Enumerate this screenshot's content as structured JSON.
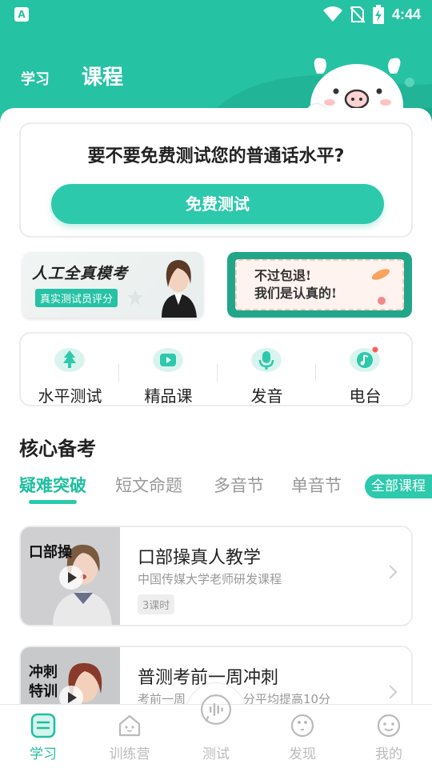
{
  "status_bar": {
    "time": "4:44",
    "left_icon": "A"
  },
  "header": {
    "tabs": [
      {
        "label": "学习"
      },
      {
        "label": "课程"
      }
    ]
  },
  "test_card": {
    "title": "要不要免费测试您的普通话水平?",
    "button": "免费测试"
  },
  "banners": {
    "left": {
      "title": "人工全真模考",
      "badge": "真实测试员评分"
    },
    "right": {
      "line1": "不过包退!",
      "line2": "我们是认真的!"
    }
  },
  "menu": [
    {
      "label": "水平测试",
      "icon": "tree-icon"
    },
    {
      "label": "精品课",
      "icon": "video-icon"
    },
    {
      "label": "发音",
      "icon": "microphone-icon"
    },
    {
      "label": "电台",
      "icon": "music-icon"
    }
  ],
  "section": {
    "title": "核心备考"
  },
  "category_tabs": {
    "items": [
      "疑难突破",
      "短文命题",
      "多音节",
      "单音节"
    ],
    "active": "疑难突破",
    "all_button": "全部课程"
  },
  "courses": [
    {
      "thumb_text": "口部操",
      "title": "口部操真人教学",
      "subtitle": "中国传媒大学老师研发课程",
      "tag": "3课时"
    },
    {
      "thumb_text_1": "冲刺",
      "thumb_text_2": "特训",
      "title": "普测考前一周冲刺",
      "subtitle": "考前一周",
      "subtitle_tail": "分平均提高10分"
    }
  ],
  "bottom_nav": [
    {
      "label": "学习",
      "icon": "study-icon",
      "active": true
    },
    {
      "label": "训练营",
      "icon": "camp-icon"
    },
    {
      "label": "测试",
      "icon": "voice-test-icon"
    },
    {
      "label": "发现",
      "icon": "discover-icon"
    },
    {
      "label": "我的",
      "icon": "profile-icon"
    }
  ],
  "colors": {
    "accent": "#25c2a3",
    "accent_light": "#2dc9ac"
  }
}
